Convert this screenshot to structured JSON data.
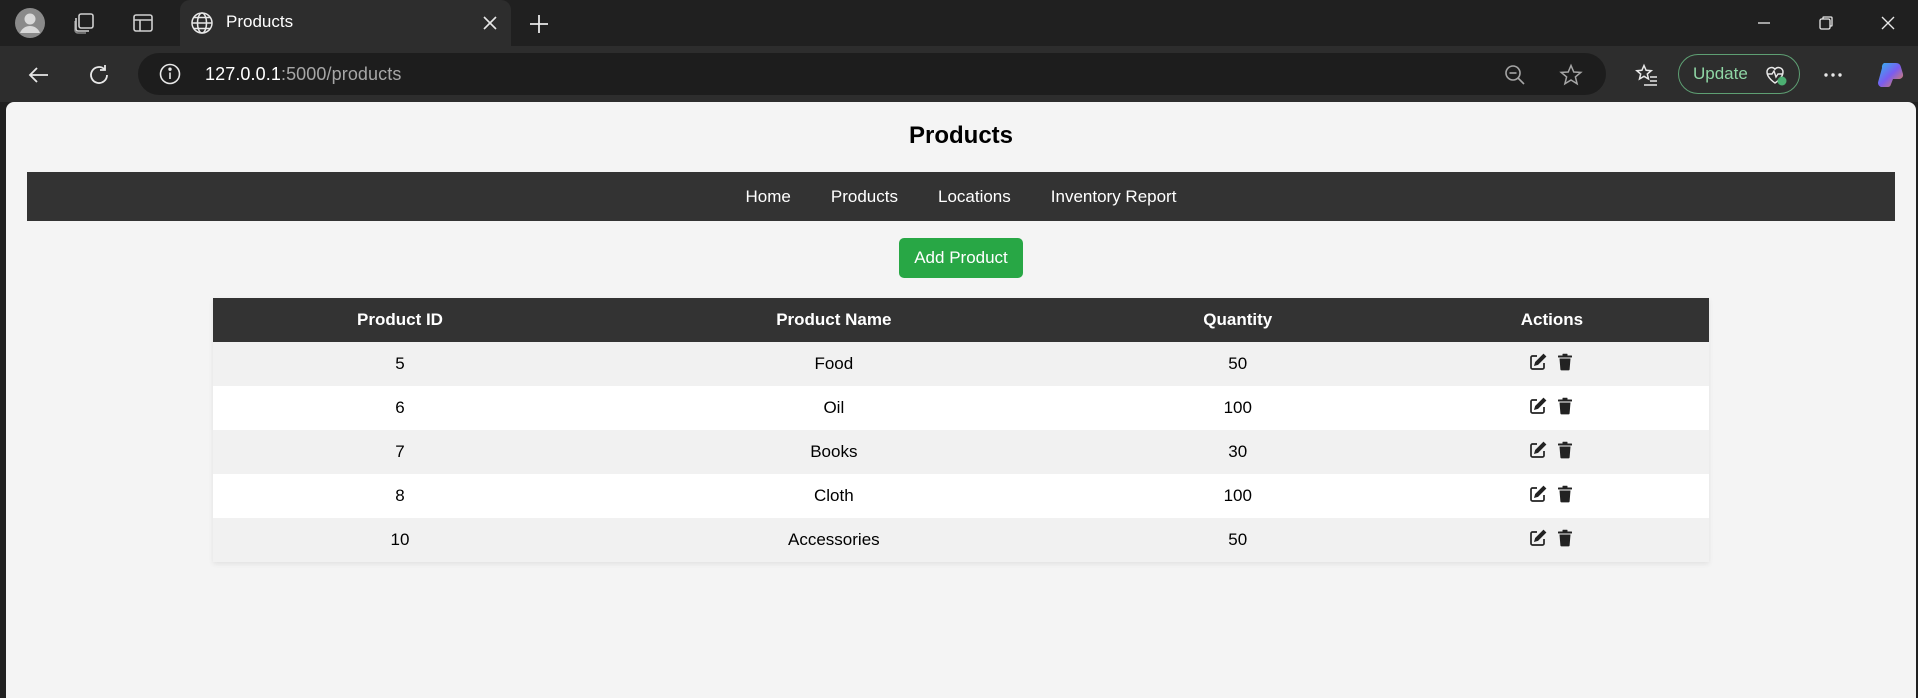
{
  "browser": {
    "tab_title": "Products",
    "url_host": "127.0.0.1",
    "url_rest": ":5000/products",
    "update_label": "Update"
  },
  "page": {
    "title": "Products",
    "nav": [
      {
        "label": "Home"
      },
      {
        "label": "Products"
      },
      {
        "label": "Locations"
      },
      {
        "label": "Inventory Report"
      }
    ],
    "add_button_label": "Add Product"
  },
  "table": {
    "headers": [
      "Product ID",
      "Product Name",
      "Quantity",
      "Actions"
    ],
    "rows": [
      {
        "id": "5",
        "name": "Food",
        "quantity": "50"
      },
      {
        "id": "6",
        "name": "Oil",
        "quantity": "100"
      },
      {
        "id": "7",
        "name": "Books",
        "quantity": "30"
      },
      {
        "id": "8",
        "name": "Cloth",
        "quantity": "100"
      },
      {
        "id": "10",
        "name": "Accessories",
        "quantity": "50"
      }
    ]
  },
  "colors": {
    "accent_green": "#28a745",
    "nav_bg": "#333333",
    "page_bg": "#f4f4f4"
  }
}
